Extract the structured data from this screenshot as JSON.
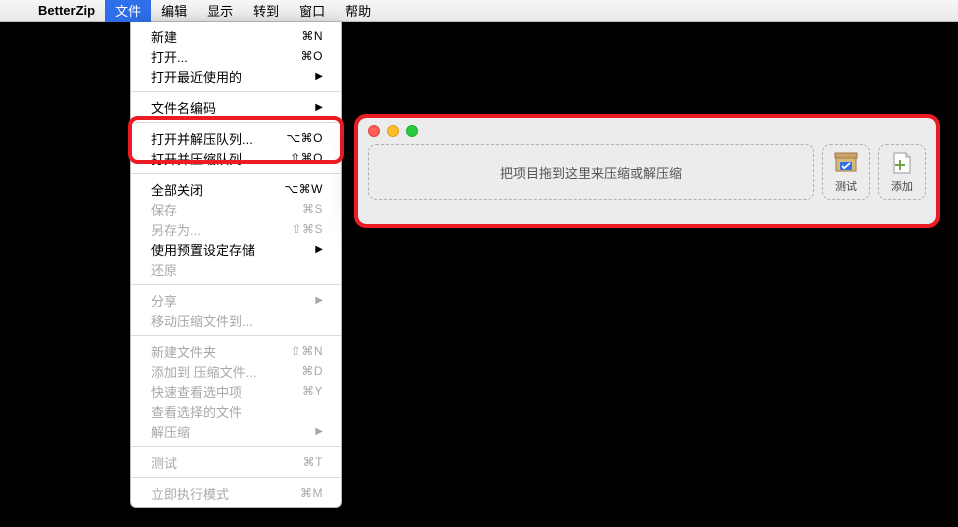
{
  "menubar": {
    "app": "BetterZip",
    "items": [
      "文件",
      "编辑",
      "显示",
      "转到",
      "窗口",
      "帮助"
    ],
    "active_index": 0
  },
  "dropdown": {
    "groups": [
      [
        {
          "label": "新建",
          "shortcut": "⌘N",
          "disabled": false
        },
        {
          "label": "打开...",
          "shortcut": "⌘O",
          "disabled": false
        },
        {
          "label": "打开最近使用的",
          "submenu": true,
          "disabled": false
        }
      ],
      [
        {
          "label": "文件名编码",
          "submenu": true,
          "disabled": false
        }
      ],
      [
        {
          "label": "打开并解压队列...",
          "shortcut": "⌥⌘O",
          "disabled": false
        },
        {
          "label": "打开并压缩队列...",
          "shortcut": "⇧⌘O",
          "disabled": false
        }
      ],
      [
        {
          "label": "全部关闭",
          "shortcut": "⌥⌘W",
          "disabled": false
        },
        {
          "label": "保存",
          "shortcut": "⌘S",
          "disabled": true
        },
        {
          "label": "另存为...",
          "shortcut": "⇧⌘S",
          "disabled": true
        },
        {
          "label": "使用预置设定存储",
          "submenu": true,
          "disabled": false
        },
        {
          "label": "还原",
          "disabled": true
        }
      ],
      [
        {
          "label": "分享",
          "submenu": true,
          "disabled": true
        },
        {
          "label": "移动压缩文件到...",
          "disabled": true
        }
      ],
      [
        {
          "label": "新建文件夹",
          "shortcut": "⇧⌘N",
          "disabled": true
        },
        {
          "label": "添加到 压缩文件...",
          "shortcut": "⌘D",
          "disabled": true
        },
        {
          "label": "快速查看选中项",
          "shortcut": "⌘Y",
          "disabled": true
        },
        {
          "label": "查看选择的文件",
          "disabled": true
        },
        {
          "label": "解压缩",
          "submenu": true,
          "disabled": true
        }
      ],
      [
        {
          "label": "测试",
          "shortcut": "⌘T",
          "disabled": true
        }
      ],
      [
        {
          "label": "立即执行模式",
          "shortcut": "⌘M",
          "disabled": true
        }
      ]
    ]
  },
  "window": {
    "dropzone_text": "把项目拖到这里来压缩或解压缩",
    "buttons": {
      "test": "测试",
      "add": "添加"
    }
  }
}
